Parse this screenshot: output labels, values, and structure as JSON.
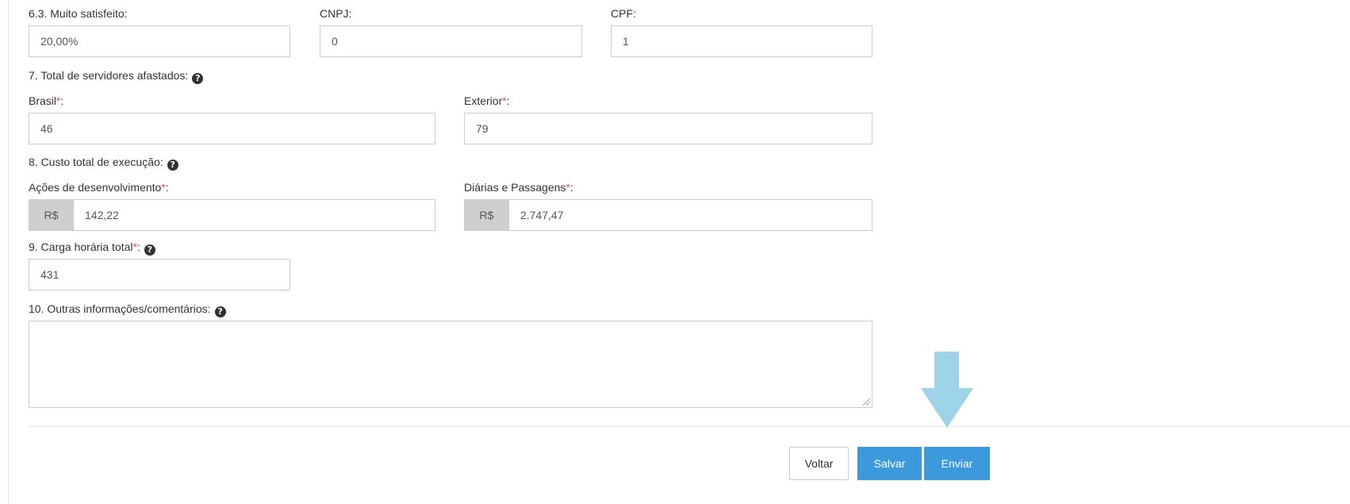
{
  "satisfaction": {
    "muito_label": "6.3. Muito satisfeito:",
    "muito_value": "20,00%",
    "cnpj_label": "CNPJ:",
    "cnpj_value": "0",
    "cpf_label": "CPF:",
    "cpf_value": "1"
  },
  "afastados": {
    "title": "7. Total de servidores afastados:",
    "brasil_label": "Brasil",
    "brasil_value": "46",
    "exterior_label": "Exterior",
    "exterior_value": "79"
  },
  "custo": {
    "title": "8. Custo total de execução:",
    "acoes_label": "Ações de desenvolvimento",
    "acoes_currency": "R$",
    "acoes_value": "142,22",
    "diarias_label": "Diárias e Passagens",
    "diarias_currency": "R$",
    "diarias_value": "2.747,47"
  },
  "carga": {
    "title": "9. Carga horária total",
    "value": "431"
  },
  "outras": {
    "title": "10. Outras informações/comentários:",
    "value": ""
  },
  "common": {
    "required_mark": "*",
    "colon": ":",
    "help_glyph": "?"
  },
  "actions": {
    "voltar": "Voltar",
    "salvar": "Salvar",
    "enviar": "Enviar"
  },
  "colors": {
    "primary": "#3c99dc",
    "required": "#d9534f",
    "arrow": "#9dd4e8"
  }
}
